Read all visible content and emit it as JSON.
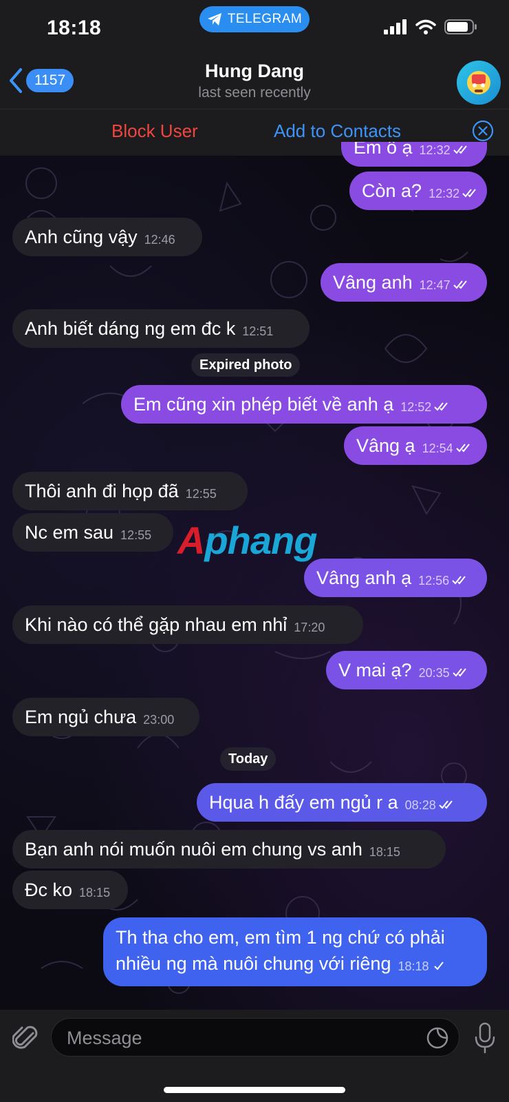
{
  "status_bar": {
    "time": "18:18",
    "app_pill": "TELEGRAM"
  },
  "nav": {
    "back_count": "1157",
    "title": "Hung Dang",
    "subtitle": "last seen recently"
  },
  "actions": {
    "block": "Block User",
    "add": "Add to Contacts"
  },
  "messages": [
    {
      "dir": "out",
      "text": "Em ổ ạ",
      "time": "12:32"
    },
    {
      "dir": "out",
      "text": "Còn a?",
      "time": "12:32"
    },
    {
      "dir": "in",
      "text": "Anh cũng vậy",
      "time": "12:46"
    },
    {
      "dir": "out",
      "text": "Vâng anh",
      "time": "12:47"
    },
    {
      "dir": "in",
      "text": "Anh biết dáng ng em đc k",
      "time": "12:51"
    },
    {
      "dir": "service",
      "text": "Expired photo"
    },
    {
      "dir": "out",
      "text": "Em cũng xin phép biết về anh ạ",
      "time": "12:52"
    },
    {
      "dir": "out",
      "text": "Vâng ạ",
      "time": "12:54"
    },
    {
      "dir": "in",
      "text": "Thôi anh đi họp đã",
      "time": "12:55"
    },
    {
      "dir": "in",
      "text": "Nc em sau",
      "time": "12:55"
    },
    {
      "dir": "out",
      "text": "Vâng anh ạ",
      "time": "12:56"
    },
    {
      "dir": "in",
      "text": "Khi nào có thể gặp nhau em nhỉ",
      "time": "17:20"
    },
    {
      "dir": "out",
      "text": "V mai ạ?",
      "time": "20:35"
    },
    {
      "dir": "in",
      "text": "Em ngủ chưa",
      "time": "23:00"
    },
    {
      "dir": "date",
      "text": "Today"
    },
    {
      "dir": "out",
      "text": "Hqua h đấy em ngủ r a",
      "time": "08:28"
    },
    {
      "dir": "in",
      "text": "Bạn anh nói muốn nuôi em chung vs anh",
      "time": "18:15"
    },
    {
      "dir": "in",
      "text": "Đc ko",
      "time": "18:15"
    },
    {
      "dir": "out",
      "line1": "Th tha cho em, em tìm 1 ng chứ có phải",
      "line2": "nhiều ng mà nuôi chung với riêng",
      "time": "18:18"
    }
  ],
  "watermark": {
    "first": "A",
    "rest": "phang"
  },
  "composer": {
    "placeholder": "Message"
  },
  "icons": {
    "back": "chevron-left-icon",
    "telegram": "paper-plane-icon",
    "close": "close-circle-icon",
    "attach": "paperclip-icon",
    "sticker": "sticker-icon",
    "mic": "microphone-icon"
  },
  "colors": {
    "accent": "#3d94f6",
    "danger": "#f2453d",
    "outgoing_bubble": "#8a4be3",
    "incoming_bubble": "#232228"
  }
}
